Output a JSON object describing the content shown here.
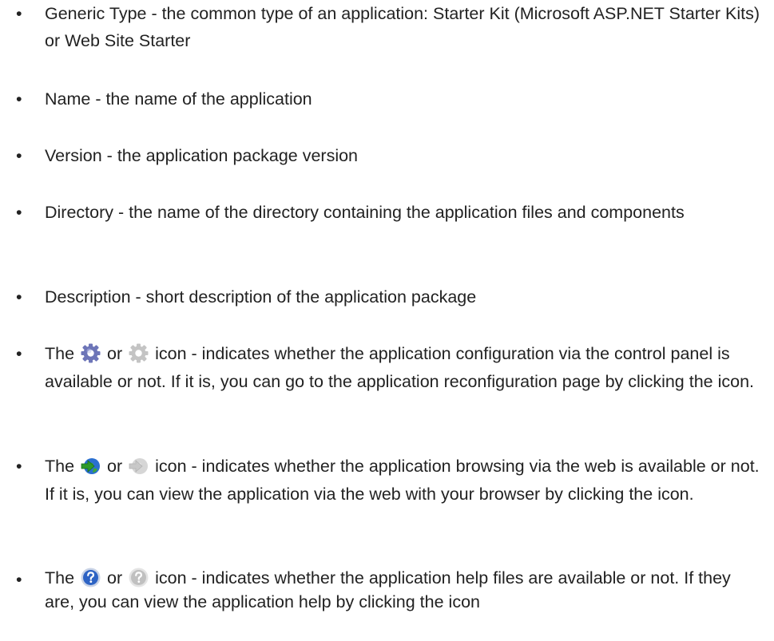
{
  "items": [
    {
      "text": "Generic Type - the common type of an application: Starter Kit (Microsoft ASP.NET Starter Kits) or Web Site Starter"
    },
    {
      "text": "Name - the name of the application"
    },
    {
      "text": "Version - the application package version"
    },
    {
      "text": "Directory - the name of the directory containing the application files and components"
    },
    {
      "text": "Description - short description of the application package"
    },
    {
      "prefix": "The",
      "or": "or",
      "rest": "icon - indicates whether the application configuration via the control panel is available or not. If it is, you can go to the application reconfiguration page by clicking the icon.",
      "icon_enabled": "gear-icon",
      "icon_disabled": "gear-disabled-icon"
    },
    {
      "prefix": "The",
      "or": "or",
      "rest": "icon - indicates whether the application browsing via the web is available or not. If it is, you can view the application via the web with your browser by clicking the icon.",
      "icon_enabled": "web-browse-icon",
      "icon_disabled": "web-browse-disabled-icon"
    },
    {
      "prefix": "The",
      "or": "or",
      "rest": "icon - indicates whether the application help files are available or not. If they are, you can view the application help by clicking the icon",
      "icon_enabled": "help-icon",
      "icon_disabled": "help-disabled-icon"
    }
  ],
  "bullet": "•",
  "colors": {
    "text": "#222222",
    "gear_enabled": "#6d75b8",
    "gear_disabled": "#c4c4c4",
    "browse_green": "#2e9a2a",
    "browse_blue": "#2a6fd0",
    "browse_disabled": "#c8c8c8",
    "help_blue": "#2d63c4",
    "help_disabled": "#c0c0c0"
  }
}
